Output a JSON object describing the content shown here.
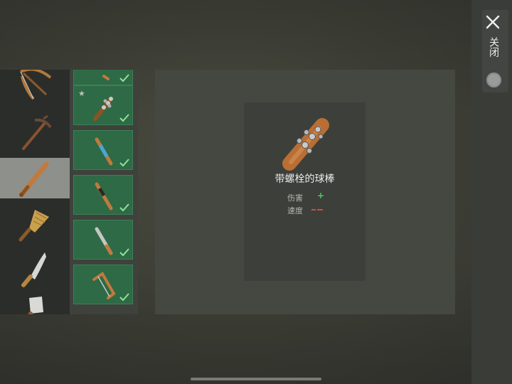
{
  "close": {
    "label": "关闭",
    "icon": "close-icon"
  },
  "categories": [
    {
      "icon": "crossbow-icon",
      "selected": false
    },
    {
      "icon": "pickaxe-icon",
      "selected": false
    },
    {
      "icon": "baseball-bat-icon",
      "selected": true
    },
    {
      "icon": "paddle-icon",
      "selected": false
    },
    {
      "icon": "machete-icon",
      "selected": false
    },
    {
      "icon": "cleaver-icon",
      "selected": false
    }
  ],
  "items": [
    {
      "icon": "bat-partial-icon",
      "checked": true,
      "starred": false
    },
    {
      "icon": "spiked-bat-icon",
      "checked": true,
      "starred": true
    },
    {
      "icon": "blue-wrapped-bat-icon",
      "checked": true,
      "starred": false
    },
    {
      "icon": "grip-bat-icon",
      "checked": true,
      "starred": false
    },
    {
      "icon": "metal-bat-icon",
      "checked": true,
      "starred": false
    },
    {
      "icon": "saw-bat-icon",
      "checked": true,
      "starred": false
    }
  ],
  "detail": {
    "name": "带螺栓的球棒",
    "stats": [
      {
        "label": "伤害",
        "indicator": "+",
        "color": "#55c85e"
      },
      {
        "label": "速度",
        "indicator": "−−",
        "color": "#d94848"
      }
    ]
  }
}
